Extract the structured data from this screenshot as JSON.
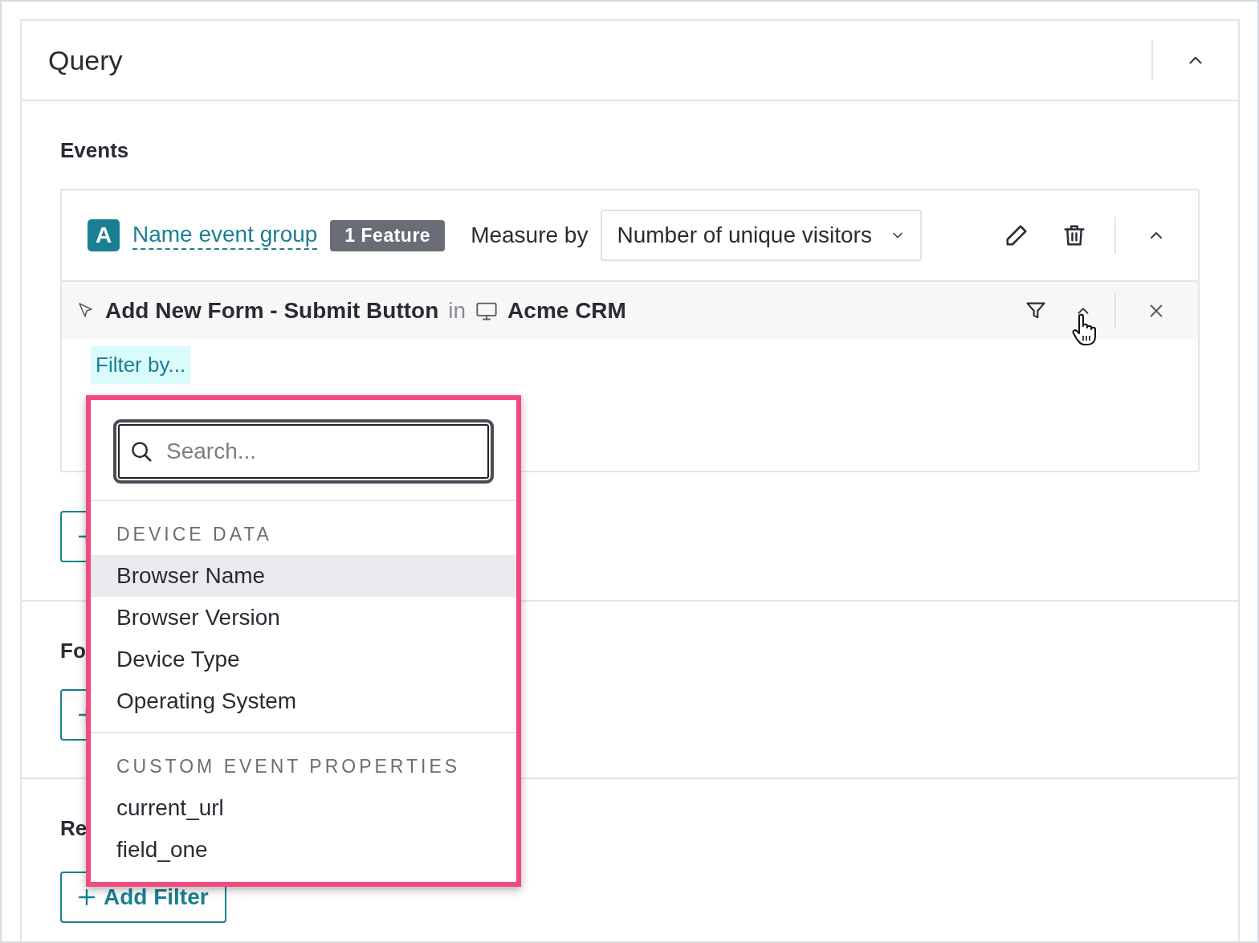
{
  "panel": {
    "title": "Query",
    "expanded": true
  },
  "sections": [
    {
      "kind": "events",
      "title": "Events",
      "event_group": {
        "letter": "A",
        "name": "Name event group",
        "badge": "1 Feature",
        "measure_label": "Measure by",
        "measure_value": "Number of unique visitors",
        "expanded": true,
        "event": {
          "name": "Add New Form - Submit Button",
          "connector": "in",
          "app": "Acme CRM",
          "expanded": true
        },
        "filter_chip": "Filter by..."
      }
    },
    {
      "kind": "plain",
      "title": "Fo"
    },
    {
      "kind": "plain",
      "title": "Re",
      "button": "Add Filter"
    }
  ],
  "dropdown": {
    "search_placeholder": "Search...",
    "groups": [
      {
        "heading": "DEVICE DATA",
        "items": [
          {
            "label": "Browser Name",
            "selected": true
          },
          {
            "label": "Browser Version",
            "selected": false
          },
          {
            "label": "Device Type",
            "selected": false
          },
          {
            "label": "Operating System",
            "selected": false
          }
        ]
      },
      {
        "heading": "CUSTOM EVENT PROPERTIES",
        "items": [
          {
            "label": "current_url",
            "selected": false
          },
          {
            "label": "field_one",
            "selected": false
          }
        ]
      }
    ]
  }
}
